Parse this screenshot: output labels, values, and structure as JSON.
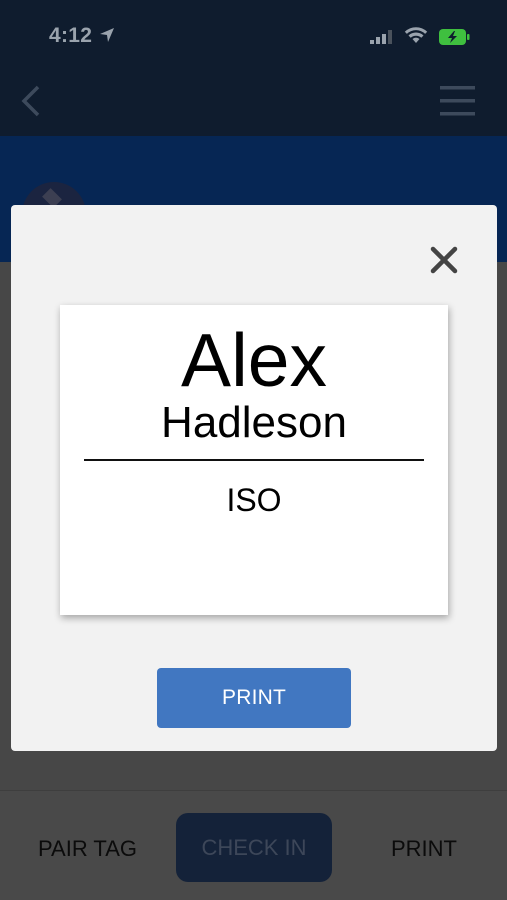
{
  "status_bar": {
    "time": "4:12",
    "icons": [
      "location-arrow-icon",
      "cellular-signal-icon",
      "wifi-icon",
      "battery-charging-icon"
    ]
  },
  "nav": {
    "icons": [
      "chevron-left-icon",
      "hamburger-menu-icon"
    ]
  },
  "modal": {
    "badge": {
      "first_name": "Alex",
      "last_name": "Hadleson",
      "organization": "ISO"
    },
    "print_label": "PRINT",
    "close_icon": "close-icon"
  },
  "bottom_bar": {
    "pair_tag_label": "PAIR TAG",
    "check_in_label": "CHECK IN",
    "print_label": "PRINT"
  },
  "colors": {
    "primary_button": "#4177c1",
    "overlay": "#474747",
    "header_dark": "#0f1c2e",
    "banner_blue": "#062654",
    "modal_bg": "#f2f2f2",
    "battery_green": "#3fbf3f"
  }
}
